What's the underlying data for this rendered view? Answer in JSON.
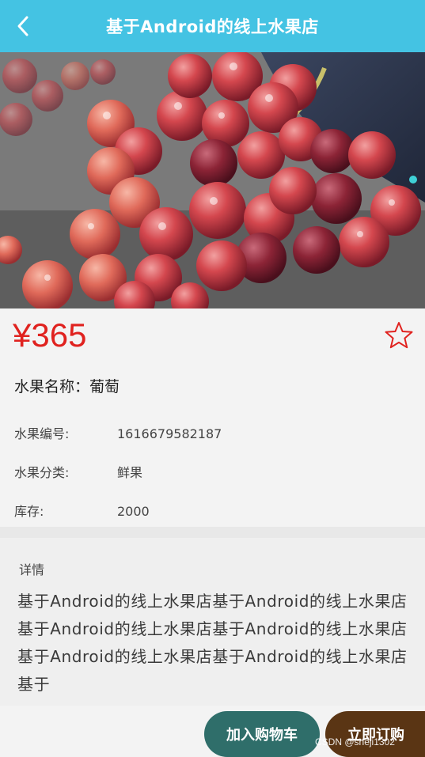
{
  "header": {
    "title": "基于Android的线上水果店"
  },
  "product": {
    "price": "¥365",
    "name_label": "水果名称：",
    "name_value": "葡萄",
    "fields": [
      {
        "label": "水果编号:",
        "value": "1616679582187"
      },
      {
        "label": "水果分类:",
        "value": "鲜果"
      },
      {
        "label": "库存:",
        "value": "2000"
      }
    ]
  },
  "detail": {
    "heading": "详情",
    "text": "基于Android的线上水果店基于Android的线上水果店基于Android的线上水果店基于Android的线上水果店基于Android的线上水果店基于Android的线上水果店基于"
  },
  "actions": {
    "add_to_cart": "加入购物车",
    "buy_now": "立即订购"
  },
  "watermark": "CSDN @sheji1302",
  "colors": {
    "header_bg": "#44c3e3",
    "price": "#e0221f",
    "cart_button": "#2f6e6a",
    "buy_button": "#5a3514"
  },
  "icons": {
    "back": "chevron-left-icon",
    "favorite": "star-outline-icon"
  }
}
